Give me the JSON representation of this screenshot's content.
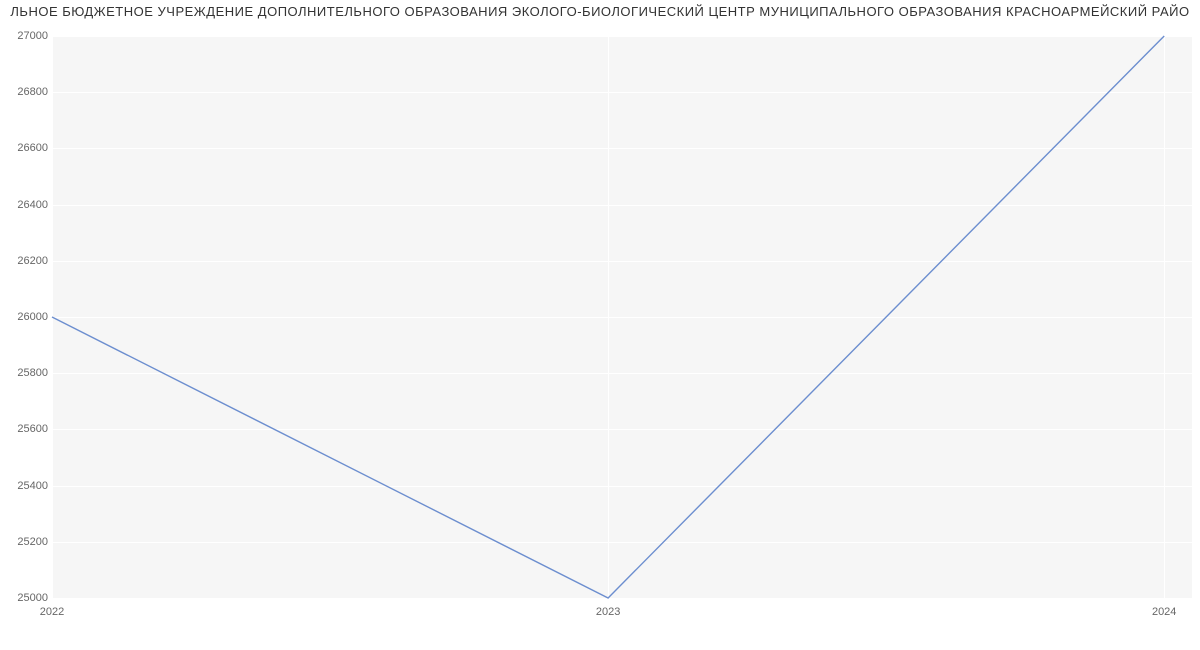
{
  "chart_data": {
    "type": "line",
    "title": "ЛЬНОЕ БЮДЖЕТНОЕ УЧРЕЖДЕНИЕ ДОПОЛНИТЕЛЬНОГО ОБРАЗОВАНИЯ ЭКОЛОГО-БИОЛОГИЧЕСКИЙ ЦЕНТР МУНИЦИПАЛЬНОГО ОБРАЗОВАНИЯ КРАСНОАРМЕЙСКИЙ РАЙО",
    "x": [
      2022,
      2023,
      2024
    ],
    "values": [
      26000,
      25000,
      27000
    ],
    "xlabel": "",
    "ylabel": "",
    "xlim": [
      2022,
      2024.05
    ],
    "ylim": [
      25000,
      27000
    ],
    "yticks": [
      25000,
      25200,
      25400,
      25600,
      25800,
      26000,
      26200,
      26400,
      26600,
      26800,
      27000
    ],
    "xticks": [
      2022,
      2023,
      2024
    ]
  },
  "colors": {
    "line": "#6c8ecf",
    "plot_bg": "#f6f6f6",
    "grid": "#ffffff",
    "text": "#666"
  }
}
